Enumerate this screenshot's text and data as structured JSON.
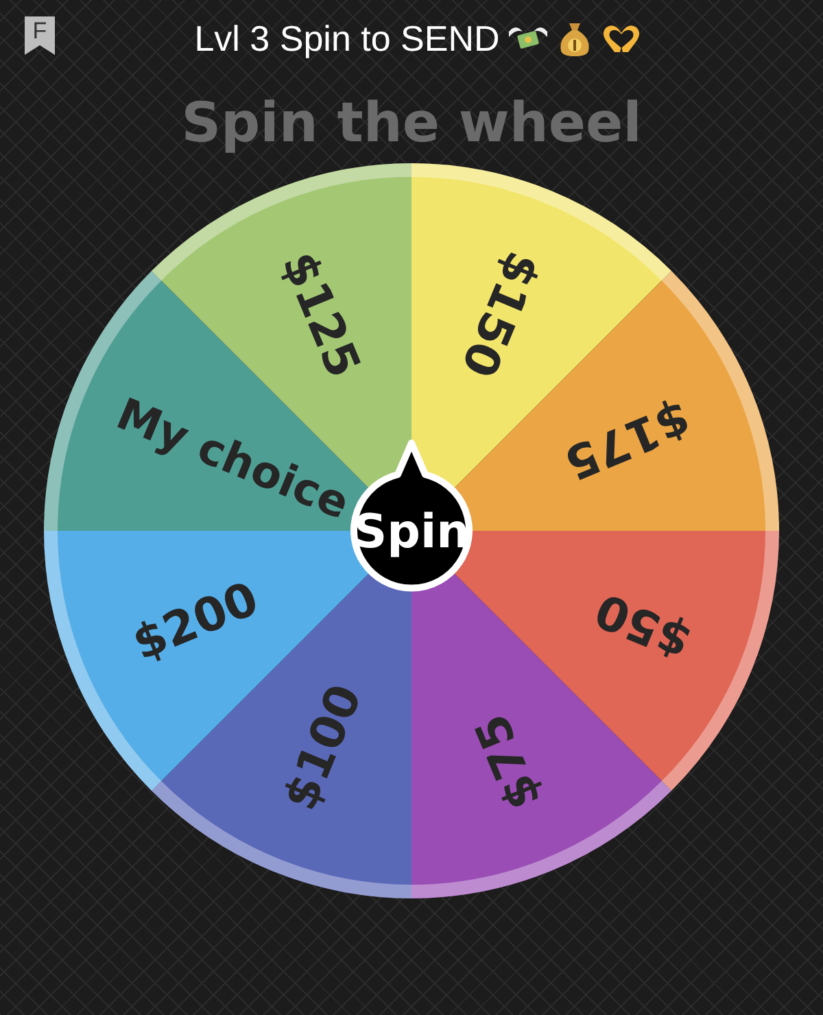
{
  "header": {
    "bookmark_letter": "F",
    "title": "Lvl 3 Spin to SEND"
  },
  "heading": "Spin the wheel",
  "wheel": {
    "segments": [
      {
        "label": "$150",
        "color": "#f2e56b"
      },
      {
        "label": "$175",
        "color": "#eba544"
      },
      {
        "label": "$50",
        "color": "#e06655"
      },
      {
        "label": "$75",
        "color": "#9a4db5"
      },
      {
        "label": "$100",
        "color": "#5a68b8"
      },
      {
        "label": "$200",
        "color": "#55aee8"
      },
      {
        "label": "My choice",
        "color": "#4f9e94"
      },
      {
        "label": "$125",
        "color": "#a3c773"
      }
    ],
    "spin_button": "Spin"
  }
}
